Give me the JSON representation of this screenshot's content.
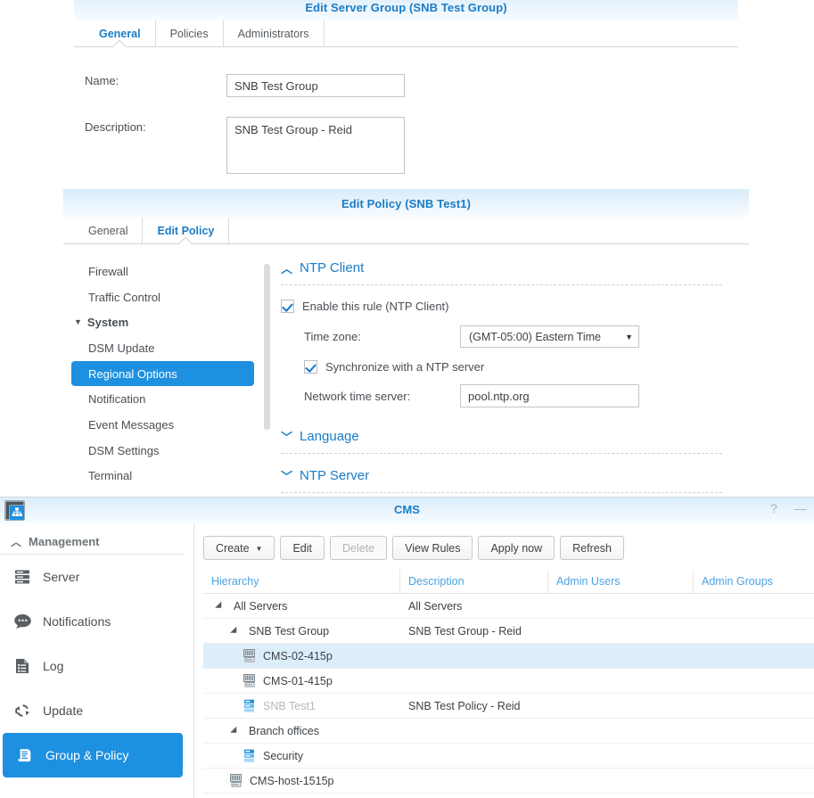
{
  "server_group_dialog": {
    "title": "Edit Server Group (SNB Test Group)",
    "tabs": [
      {
        "label": "General",
        "active": true
      },
      {
        "label": "Policies",
        "active": false
      },
      {
        "label": "Administrators",
        "active": false
      }
    ],
    "name_label": "Name:",
    "name_value": "SNB Test Group",
    "description_label": "Description:",
    "description_value": "SNB Test Group - Reid"
  },
  "policy_dialog": {
    "title": "Edit Policy (SNB Test1)",
    "tabs": [
      {
        "label": "General",
        "active": false
      },
      {
        "label": "Edit Policy",
        "active": true
      }
    ],
    "nav": [
      {
        "label": "Firewall",
        "type": "item",
        "selected": false
      },
      {
        "label": "Traffic Control",
        "type": "item",
        "selected": false
      },
      {
        "label": "System",
        "type": "group",
        "selected": false
      },
      {
        "label": "DSM Update",
        "type": "item",
        "selected": false
      },
      {
        "label": "Regional Options",
        "type": "item",
        "selected": true
      },
      {
        "label": "Notification",
        "type": "item",
        "selected": false
      },
      {
        "label": "Event Messages",
        "type": "item",
        "selected": false
      },
      {
        "label": "DSM Settings",
        "type": "item",
        "selected": false
      },
      {
        "label": "Terminal",
        "type": "item",
        "selected": false
      }
    ],
    "sections": {
      "ntp_client": {
        "title": "NTP Client",
        "expanded": true,
        "enable_label": "Enable this rule (NTP Client)",
        "enable_checked": true,
        "timezone_label": "Time zone:",
        "timezone_value": "(GMT-05:00) Eastern Time",
        "sync_label": "Synchronize with a NTP server",
        "sync_checked": true,
        "server_label": "Network time server:",
        "server_value": "pool.ntp.org"
      },
      "language": {
        "title": "Language",
        "expanded": false
      },
      "ntp_server": {
        "title": "NTP Server",
        "expanded": false
      }
    }
  },
  "cms_window": {
    "title": "CMS",
    "app_icon": "cms-app-icon",
    "help_icon": "?",
    "minimize_icon": "—",
    "sidebar": {
      "section_label": "Management",
      "items": [
        {
          "label": "Server",
          "icon": "server-icon",
          "active": false
        },
        {
          "label": "Notifications",
          "icon": "speech-bubble-icon",
          "active": false
        },
        {
          "label": "Log",
          "icon": "log-document-icon",
          "active": false
        },
        {
          "label": "Update",
          "icon": "refresh-arrows-icon",
          "active": false
        },
        {
          "label": "Group & Policy",
          "icon": "policy-scroll-icon",
          "active": true
        }
      ]
    },
    "toolbar": [
      {
        "label": "Create",
        "dropdown": true,
        "disabled": false
      },
      {
        "label": "Edit",
        "dropdown": false,
        "disabled": false
      },
      {
        "label": "Delete",
        "dropdown": false,
        "disabled": true
      },
      {
        "label": "View Rules",
        "dropdown": false,
        "disabled": false
      },
      {
        "label": "Apply now",
        "dropdown": false,
        "disabled": false
      },
      {
        "label": "Refresh",
        "dropdown": false,
        "disabled": false
      }
    ],
    "grid": {
      "columns": [
        "Hierarchy",
        "Description",
        "Admin Users",
        "Admin Groups"
      ],
      "rows": [
        {
          "indent": 0,
          "twisty": "expanded",
          "icon": "none",
          "name": "All Servers",
          "description": "All Servers",
          "admin_users": "",
          "admin_groups": "",
          "selected": false,
          "muted": false
        },
        {
          "indent": 1,
          "twisty": "expanded",
          "icon": "none",
          "name": "SNB Test Group",
          "description": "SNB Test Group - Reid",
          "admin_users": "",
          "admin_groups": "",
          "selected": false,
          "muted": false
        },
        {
          "indent": 2,
          "twisty": "none",
          "icon": "server-icon",
          "name": "CMS-02-415p",
          "description": "",
          "admin_users": "",
          "admin_groups": "",
          "selected": true,
          "muted": false
        },
        {
          "indent": 2,
          "twisty": "none",
          "icon": "server-icon",
          "name": "CMS-01-415p",
          "description": "",
          "admin_users": "",
          "admin_groups": "",
          "selected": false,
          "muted": false
        },
        {
          "indent": 2,
          "twisty": "none",
          "icon": "policy-icon",
          "name": "SNB Test1",
          "description": "SNB Test Policy - Reid",
          "admin_users": "",
          "admin_groups": "",
          "selected": false,
          "muted": true
        },
        {
          "indent": 1,
          "twisty": "expanded",
          "icon": "none",
          "name": "Branch offices",
          "description": "",
          "admin_users": "",
          "admin_groups": "",
          "selected": false,
          "muted": false
        },
        {
          "indent": 2,
          "twisty": "none",
          "icon": "policy-icon",
          "name": "Security",
          "description": "",
          "admin_users": "",
          "admin_groups": "",
          "selected": false,
          "muted": false
        },
        {
          "indent": 1,
          "twisty": "none",
          "icon": "server-icon",
          "name": "CMS-host-1515p",
          "description": "",
          "admin_users": "",
          "admin_groups": "",
          "selected": false,
          "muted": false
        }
      ]
    }
  },
  "colors": {
    "accent_blue": "#1a7cc6",
    "selection_blue": "#1e90e0",
    "row_selection": "#ddeefb",
    "header_link": "#4ba3e3",
    "text": "#3d4246",
    "muted_text": "#b3b8bc"
  }
}
